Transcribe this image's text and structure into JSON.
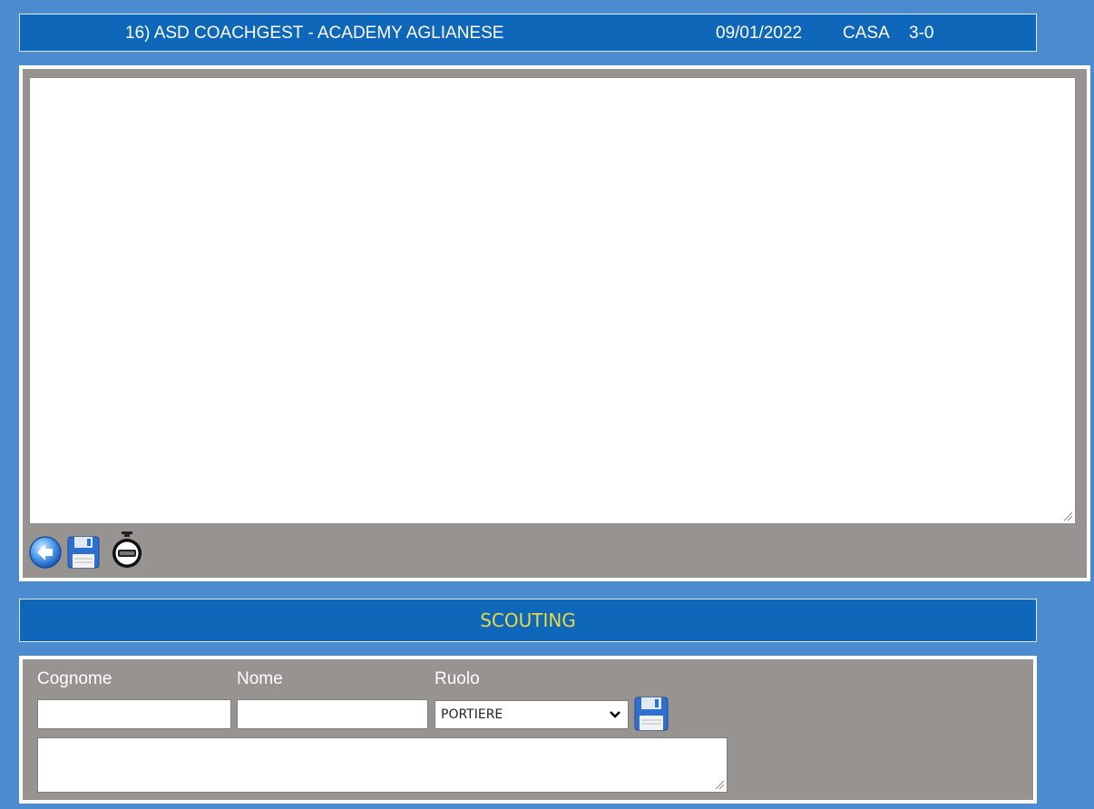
{
  "header": {
    "team": "16) ASD COACHGEST - ACADEMY AGLIANESE",
    "date": "09/01/2022",
    "place": "CASA",
    "score": "3-0"
  },
  "notes": {
    "value": ""
  },
  "toolbar": {
    "icons": [
      "back-arrow-icon",
      "save-floppy-icon",
      "stopwatch-icon"
    ]
  },
  "scouting": {
    "title": "SCOUTING",
    "labels": {
      "surname": "Cognome",
      "name": "Nome",
      "role": "Ruolo"
    },
    "surname_value": "",
    "name_value": "",
    "role_selected": "PORTIERE",
    "notes_value": ""
  },
  "colors": {
    "background": "#4a8ccf",
    "bar": "#0e67b8",
    "panel": "#979390",
    "scouting_title": "#e8d84a"
  }
}
